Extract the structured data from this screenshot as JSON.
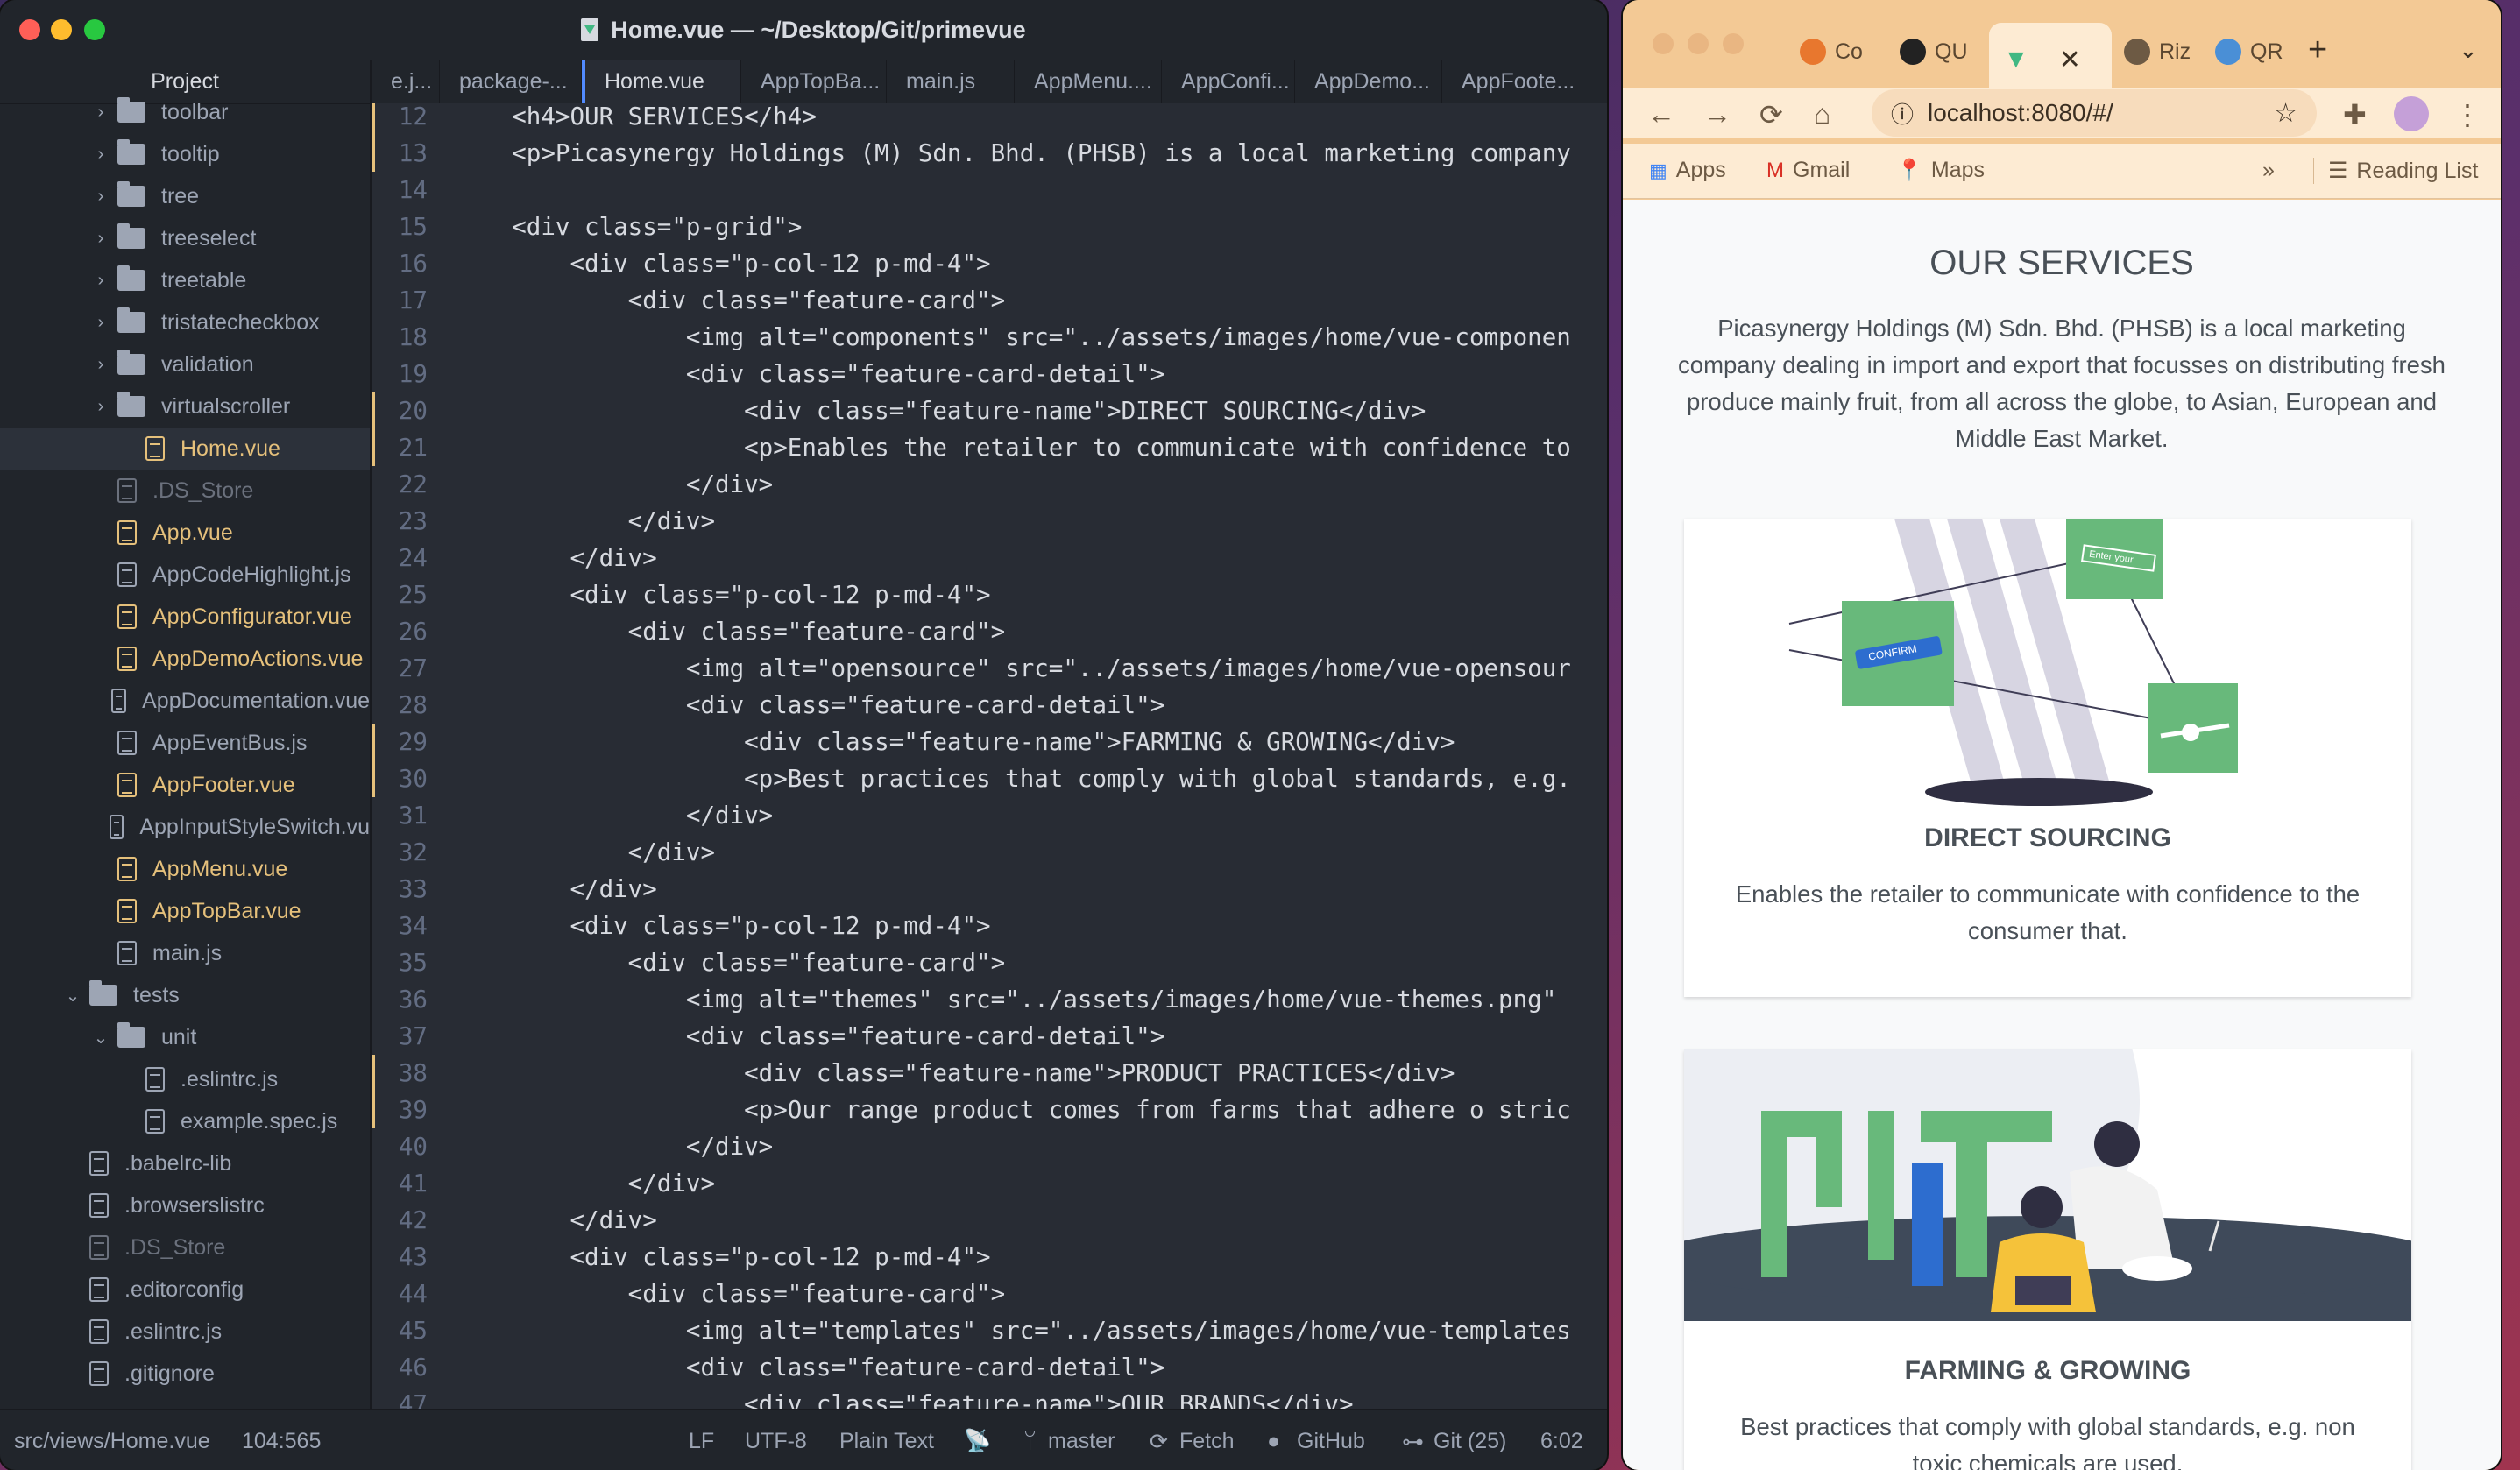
{
  "editor": {
    "title": "Home.vue — ~/Desktop/Git/primevue",
    "project_label": "Project",
    "tree": [
      {
        "label": "toolbar",
        "type": "folder"
      },
      {
        "label": "tooltip",
        "type": "folder"
      },
      {
        "label": "tree",
        "type": "folder"
      },
      {
        "label": "treeselect",
        "type": "folder"
      },
      {
        "label": "treetable",
        "type": "folder"
      },
      {
        "label": "tristatecheckbox",
        "type": "folder"
      },
      {
        "label": "validation",
        "type": "folder"
      },
      {
        "label": "virtualscroller",
        "type": "folder"
      },
      {
        "label": "Home.vue",
        "type": "file-modified"
      },
      {
        "label": ".DS_Store",
        "type": "file-ignored"
      },
      {
        "label": "App.vue",
        "type": "file-modified"
      },
      {
        "label": "AppCodeHighlight.js",
        "type": "file"
      },
      {
        "label": "AppConfigurator.vue",
        "type": "file-modified"
      },
      {
        "label": "AppDemoActions.vue",
        "type": "file-modified"
      },
      {
        "label": "AppDocumentation.vue",
        "type": "file"
      },
      {
        "label": "AppEventBus.js",
        "type": "file"
      },
      {
        "label": "AppFooter.vue",
        "type": "file-modified"
      },
      {
        "label": "AppInputStyleSwitch.vu",
        "type": "file"
      },
      {
        "label": "AppMenu.vue",
        "type": "file-modified"
      },
      {
        "label": "AppTopBar.vue",
        "type": "file-modified"
      },
      {
        "label": "main.js",
        "type": "file"
      },
      {
        "label": "tests",
        "type": "folder-open"
      },
      {
        "label": "unit",
        "type": "folder-open"
      },
      {
        "label": ".eslintrc.js",
        "type": "file"
      },
      {
        "label": "example.spec.js",
        "type": "file"
      },
      {
        "label": ".babelrc-lib",
        "type": "file"
      },
      {
        "label": ".browserslistrc",
        "type": "file"
      },
      {
        "label": ".DS_Store",
        "type": "file-ignored"
      },
      {
        "label": ".editorconfig",
        "type": "file"
      },
      {
        "label": ".eslintrc.js",
        "type": "file"
      },
      {
        "label": ".gitignore",
        "type": "file"
      }
    ],
    "tabs": [
      "e.j...",
      "package-...",
      "Home.vue",
      "AppTopBa...",
      "main.js",
      "AppMenu....",
      "AppConfi...",
      "AppDemo...",
      "AppFoote..."
    ],
    "active_tab": "Home.vue",
    "code_lines": [
      {
        "n": "12",
        "t": "    <h4>OUR SERVICES</h4>"
      },
      {
        "n": "13",
        "t": "    <p>Picasynergy Holdings (M) Sdn. Bhd. (PHSB) is a local marketing company"
      },
      {
        "n": "14",
        "t": ""
      },
      {
        "n": "15",
        "t": "    <div class=\"p-grid\">"
      },
      {
        "n": "16",
        "t": "        <div class=\"p-col-12 p-md-4\">"
      },
      {
        "n": "17",
        "t": "            <div class=\"feature-card\">"
      },
      {
        "n": "18",
        "t": "                <img alt=\"components\" src=\"../assets/images/home/vue-componen"
      },
      {
        "n": "19",
        "t": "                <div class=\"feature-card-detail\">"
      },
      {
        "n": "20",
        "t": "                    <div class=\"feature-name\">DIRECT SOURCING</div>"
      },
      {
        "n": "21",
        "t": "                    <p>Enables the retailer to communicate with confidence to"
      },
      {
        "n": "22",
        "t": "                </div>"
      },
      {
        "n": "23",
        "t": "            </div>"
      },
      {
        "n": "24",
        "t": "        </div>"
      },
      {
        "n": "25",
        "t": "        <div class=\"p-col-12 p-md-4\">"
      },
      {
        "n": "26",
        "t": "            <div class=\"feature-card\">"
      },
      {
        "n": "27",
        "t": "                <img alt=\"opensource\" src=\"../assets/images/home/vue-opensour"
      },
      {
        "n": "28",
        "t": "                <div class=\"feature-card-detail\">"
      },
      {
        "n": "29",
        "t": "                    <div class=\"feature-name\">FARMING & GROWING</div>"
      },
      {
        "n": "30",
        "t": "                    <p>Best practices that comply with global standards, e.g."
      },
      {
        "n": "31",
        "t": "                </div>"
      },
      {
        "n": "32",
        "t": "            </div>"
      },
      {
        "n": "33",
        "t": "        </div>"
      },
      {
        "n": "34",
        "t": "        <div class=\"p-col-12 p-md-4\">"
      },
      {
        "n": "35",
        "t": "            <div class=\"feature-card\">"
      },
      {
        "n": "36",
        "t": "                <img alt=\"themes\" src=\"../assets/images/home/vue-themes.png\""
      },
      {
        "n": "37",
        "t": "                <div class=\"feature-card-detail\">"
      },
      {
        "n": "38",
        "t": "                    <div class=\"feature-name\">PRODUCT PRACTICES</div>"
      },
      {
        "n": "39",
        "t": "                    <p>Our range product comes from farms that adhere o stric"
      },
      {
        "n": "40",
        "t": "                </div>"
      },
      {
        "n": "41",
        "t": "            </div>"
      },
      {
        "n": "42",
        "t": "        </div>"
      },
      {
        "n": "43",
        "t": "        <div class=\"p-col-12 p-md-4\">"
      },
      {
        "n": "44",
        "t": "            <div class=\"feature-card\">"
      },
      {
        "n": "45",
        "t": "                <img alt=\"templates\" src=\"../assets/images/home/vue-templates"
      },
      {
        "n": "46",
        "t": "                <div class=\"feature-card-detail\">"
      },
      {
        "n": "47",
        "t": "                    <div class=\"feature-name\">OUR BRANDS</div>"
      }
    ],
    "status": {
      "path": "src/views/Home.vue",
      "cursor": "104:565",
      "line_ending": "LF",
      "encoding": "UTF-8",
      "grammar": "Plain Text",
      "branch": "master",
      "fetch": "Fetch",
      "github": "GitHub",
      "git": "Git (25)",
      "time": "6:02"
    }
  },
  "browser": {
    "tabs": [
      "Co",
      "QU",
      "",
      "Riz",
      "QR"
    ],
    "url": "localhost:8080/#/",
    "bookmarks": {
      "apps": "Apps",
      "gmail": "Gmail",
      "maps": "Maps",
      "more": "»",
      "reading_list": "Reading List"
    },
    "page": {
      "title": "OUR SERVICES",
      "intro": "Picasynergy Holdings (M) Sdn. Bhd. (PHSB) is a local marketing company dealing in import and export that focusses on distributing fresh produce mainly fruit, from all across the globe, to Asian, European and Middle East Market.",
      "cards": [
        {
          "name": "DIRECT SOURCING",
          "desc": "Enables the retailer to communicate with confidence to the consumer that.",
          "img_button_text": "CONFIRM",
          "img_input_text": "Enter your"
        },
        {
          "name": "FARMING & GROWING",
          "desc": "Best practices that comply with global standards, e.g. non toxic chemicals are used."
        }
      ]
    }
  }
}
